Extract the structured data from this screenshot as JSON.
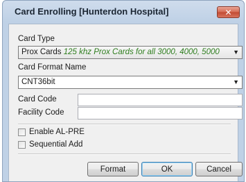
{
  "window": {
    "title": "Card Enrolling [Hunterdon Hospital]",
    "close_glyph": "✕"
  },
  "form": {
    "card_type": {
      "label": "Card Type",
      "selected_name": "Prox Cards",
      "selected_desc": "125 khz Prox Cards for all 3000, 4000, 5000"
    },
    "card_format": {
      "label": "Card Format Name",
      "selected": "CNT36bit"
    },
    "card_code": {
      "label": "Card Code",
      "value": ""
    },
    "facility_code": {
      "label": "Facility Code",
      "value": ""
    },
    "enable_al_pre": {
      "label": "Enable AL-PRE",
      "checked": false
    },
    "sequential_add": {
      "label": "Sequential Add",
      "checked": false
    }
  },
  "buttons": {
    "format": "Format",
    "ok": "OK",
    "cancel": "Cancel"
  },
  "icons": {
    "dropdown": "▼"
  }
}
